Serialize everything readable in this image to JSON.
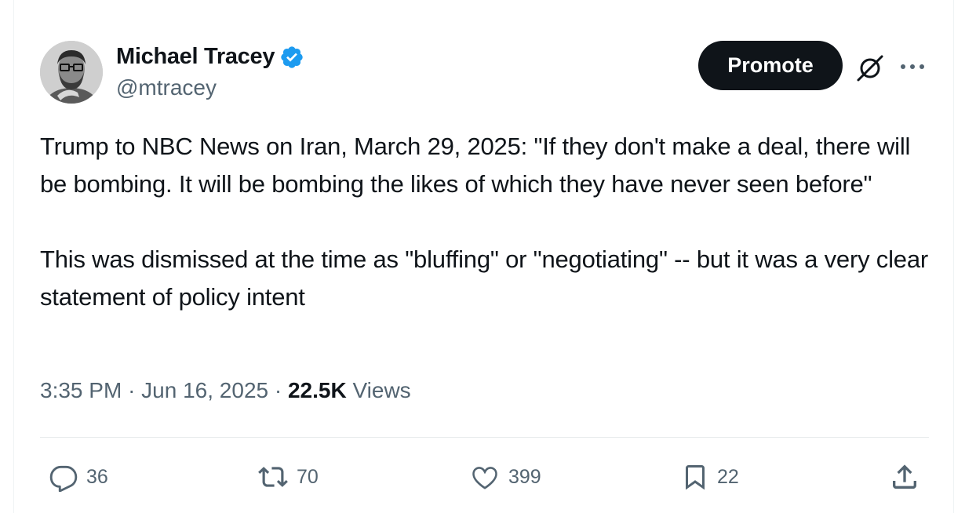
{
  "author": {
    "name": "Michael Tracey",
    "handle": "@mtracey",
    "verified": true
  },
  "header": {
    "promote_label": "Promote"
  },
  "tweet": {
    "paragraph1": "Trump to NBC News on Iran, March 29, 2025: \"If they don't make a deal, there will be bombing. It will be bombing the likes of which they have never seen before\"",
    "paragraph2": "This was dismissed at the time as \"bluffing\" or \"negotiating\" -- but it was a very clear statement of policy intent"
  },
  "meta": {
    "time": "3:35 PM",
    "separator": "·",
    "date": "Jun 16, 2025",
    "views_count": "22.5K",
    "views_label": "Views"
  },
  "actions": {
    "replies": "36",
    "reposts": "70",
    "likes": "399",
    "bookmarks": "22"
  },
  "icons": {
    "verified": "verified-badge-icon",
    "grok": "grok-icon",
    "more": "more-icon",
    "reply": "reply-icon",
    "repost": "repost-icon",
    "like": "heart-icon",
    "bookmark": "bookmark-icon",
    "share": "share-icon"
  },
  "colors": {
    "text": "#0f1419",
    "secondary": "#536471",
    "verified": "#1d9bf0",
    "button_bg": "#0f1419"
  }
}
